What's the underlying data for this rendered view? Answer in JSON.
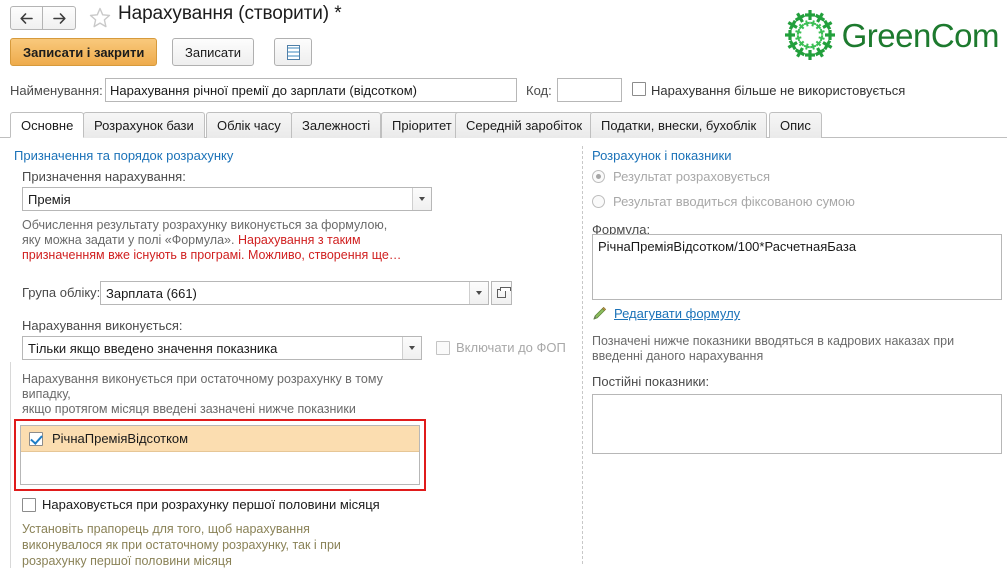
{
  "window": {
    "title": "Нарахування (створити) *",
    "back_icon": "arrow-left-icon",
    "forward_icon": "arrow-right-icon",
    "favorite_icon": "star-icon"
  },
  "brand": {
    "name": "GreenCom",
    "color": "#1d7a2e",
    "mark_icon": "green-crosses-circle-logo"
  },
  "toolbar": {
    "save_close_label": "Записати і закрити",
    "save_label": "Записати",
    "journal_button_icon": "journal-list-icon"
  },
  "header": {
    "name_label": "Найменування:",
    "name_value": "Нарахування річної премії до зарплати (відсотком)",
    "code_label": "Код:",
    "code_value": "",
    "not_used_label": "Нарахування більше не використовується",
    "not_used_checked": false
  },
  "tabs": [
    {
      "label": "Основне",
      "active": true
    },
    {
      "label": "Розрахунок бази",
      "active": false
    },
    {
      "label": "Облік часу",
      "active": false
    },
    {
      "label": "Залежності",
      "active": false
    },
    {
      "label": "Пріоритет",
      "active": false
    },
    {
      "label": "Середній заробіток",
      "active": false
    },
    {
      "label": "Податки, внески, бухоблік",
      "active": false
    },
    {
      "label": "Опис",
      "active": false
    }
  ],
  "left": {
    "section_title": "Призначення та порядок розрахунку",
    "purpose_label": "Призначення нарахування:",
    "purpose_value": "Премія",
    "help_line1": "Обчислення результату розрахунку виконується за формулою,",
    "help_line2_normal": "яку можна задати у полі «Формула». ",
    "help_line2_red": "Нарахування з таким",
    "help_line3_red": "призначенням вже існують в програмі. Можливо, створення ще…",
    "group_label": "Група обліку:",
    "group_value": "Зарплата (661)",
    "exec_label": "Нарахування виконується:",
    "exec_value": "Тільки якщо введено значення показника",
    "fop_label": "Включати до ФОП",
    "fop_checked": false,
    "cond_line1": "Нарахування виконується при остаточному розрахунку в тому",
    "cond_line2": "випадку,",
    "cond_line3": "якщо протягом місяця введені зазначені нижче показники",
    "indicators": [
      {
        "label": "РічнаПреміяВідсотком",
        "checked": true
      }
    ],
    "first_half_label": "Нараховується при розрахунку першої половини місяця",
    "first_half_checked": false,
    "footer_line1": "Установіть прапорець для того, щоб нарахування",
    "footer_line2": "виконувалося як при остаточному розрахунку, так і при",
    "footer_line3": "розрахунку першої половини місяця"
  },
  "right": {
    "section_title": "Розрахунок і показники",
    "radio_calculated_label": "Результат розраховується",
    "radio_calculated_selected": true,
    "radio_fixed_label": "Результат вводиться фіксованою сумою",
    "radio_fixed_selected": false,
    "formula_label": "Формула:",
    "formula_value": "РічнаПреміяВідсотком/100*РасчетнаяБаза",
    "edit_formula_label": "Редагувати формулу",
    "edit_formula_icon": "pencil-icon",
    "note_line1": "Позначені нижче показники вводяться в кадрових наказах при",
    "note_line2": "введенні даного нарахування",
    "constants_label": "Постійні показники:"
  },
  "colors": {
    "accent_orange": "#eeab4c",
    "link_blue": "#1b72b8",
    "highlight_red": "#e01b1b",
    "row_highlight": "#fbddb0"
  }
}
